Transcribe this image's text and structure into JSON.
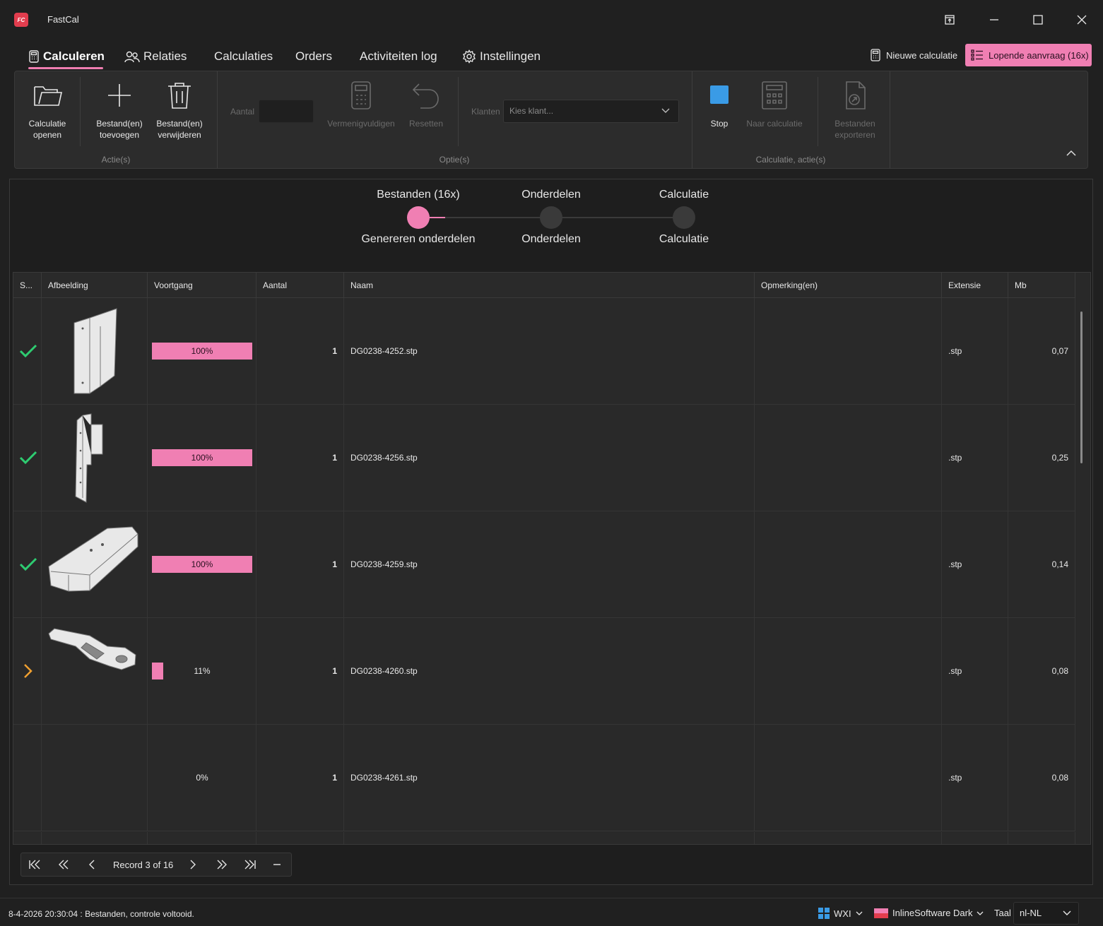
{
  "app": {
    "title": "FastCal",
    "logo_text": "FC"
  },
  "nav": {
    "tabs": [
      {
        "label": "Calculeren"
      },
      {
        "label": "Relaties"
      },
      {
        "label": "Calculaties"
      },
      {
        "label": "Orders"
      },
      {
        "label": "Activiteiten log"
      },
      {
        "label": "Instellingen"
      }
    ],
    "new_calc_label": "Nieuwe calculatie",
    "lopende_label": "Lopende aanvraag (16x)"
  },
  "ribbon": {
    "open_label": "Calculatie openen",
    "add_label": "Bestand(en) toevoegen",
    "remove_label": "Bestand(en) verwijderen",
    "group_actions": "Actie(s)",
    "aantal_label": "Aantal",
    "multiply_label": "Vermenigvuldigen",
    "reset_label": "Resetten",
    "klanten_label": "Klanten",
    "klant_placeholder": "Kies klant...",
    "group_options": "Optie(s)",
    "stop_label": "Stop",
    "to_calc_label": "Naar calculatie",
    "export_label": "Bestanden exporteren",
    "group_calc_actions": "Calculatie, actie(s)"
  },
  "stepper": {
    "steps": [
      {
        "top": "Bestanden (16x)",
        "bottom": "Genereren onderdelen",
        "active": true
      },
      {
        "top": "Onderdelen",
        "bottom": "Onderdelen",
        "active": false
      },
      {
        "top": "Calculatie",
        "bottom": "Calculatie",
        "active": false
      }
    ]
  },
  "grid": {
    "columns": [
      "S...",
      "Afbeelding",
      "Voortgang",
      "Aantal",
      "Naam",
      "Opmerking(en)",
      "Extensie",
      "Mb"
    ],
    "rows": [
      {
        "status": "check",
        "progress": 100,
        "progress_text": "100%",
        "aantal": "1",
        "naam": "DG0238-4252.stp",
        "opmerking": "",
        "extensie": ".stp",
        "mb": "0,07"
      },
      {
        "status": "check",
        "progress": 100,
        "progress_text": "100%",
        "aantal": "1",
        "naam": "DG0238-4256.stp",
        "opmerking": "",
        "extensie": ".stp",
        "mb": "0,25"
      },
      {
        "status": "check",
        "progress": 100,
        "progress_text": "100%",
        "aantal": "1",
        "naam": "DG0238-4259.stp",
        "opmerking": "",
        "extensie": ".stp",
        "mb": "0,14"
      },
      {
        "status": "current",
        "progress": 11,
        "progress_text": "11%",
        "aantal": "1",
        "naam": "DG0238-4260.stp",
        "opmerking": "",
        "extensie": ".stp",
        "mb": "0,08"
      },
      {
        "status": "none",
        "progress": 0,
        "progress_text": "0%",
        "aantal": "1",
        "naam": "DG0238-4261.stp",
        "opmerking": "",
        "extensie": ".stp",
        "mb": "0,08"
      }
    ]
  },
  "pager": {
    "record_text": "Record 3 of 16"
  },
  "status": {
    "message": "8-4-2026 20:30:04 : Bestanden, controle voltooid.",
    "workspace": "WXI",
    "theme": "InlineSoftware Dark",
    "taal_label": "Taal",
    "language": "nl-NL"
  },
  "colors": {
    "accent": "#f07fb3",
    "check": "#2ecc71",
    "current": "#f0a030",
    "stop": "#3a9be6",
    "logo": "#e23d4e"
  }
}
